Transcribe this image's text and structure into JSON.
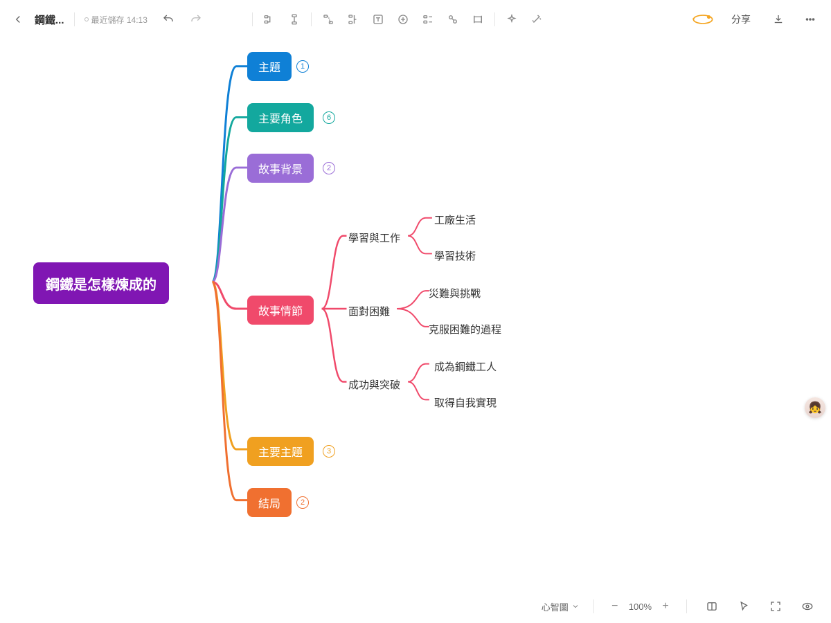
{
  "header": {
    "docTitle": "鋼鐵...",
    "saveLabel": "最近儲存 14:13",
    "shareLabel": "分享"
  },
  "bottom": {
    "viewMode": "心智圖",
    "zoom": "100%"
  },
  "mindmap": {
    "root": {
      "label": "鋼鐵是怎樣煉成的",
      "color": "#8016b3"
    },
    "branches": [
      {
        "id": "topic",
        "label": "主題",
        "color": "#0f80d6",
        "count": "1"
      },
      {
        "id": "chars",
        "label": "主要角色",
        "color": "#13a89e",
        "count": "6"
      },
      {
        "id": "bg",
        "label": "故事背景",
        "color": "#9a6dd7",
        "count": "2"
      },
      {
        "id": "plot",
        "label": "故事情節",
        "color": "#f04a6b",
        "count": ""
      },
      {
        "id": "themes",
        "label": "主要主題",
        "color": "#f0a020",
        "count": "3"
      },
      {
        "id": "ending",
        "label": "結局",
        "color": "#f07030",
        "count": "2"
      }
    ],
    "plotSub": [
      {
        "id": "learn",
        "label": "學習與工作",
        "children": [
          "工廠生活",
          "學習技術"
        ]
      },
      {
        "id": "face",
        "label": "面對困難",
        "children": [
          "災難與挑戰",
          "克服困難的過程"
        ]
      },
      {
        "id": "succeed",
        "label": "成功與突破",
        "children": [
          "成為鋼鐵工人",
          "取得自我實現"
        ]
      }
    ]
  }
}
